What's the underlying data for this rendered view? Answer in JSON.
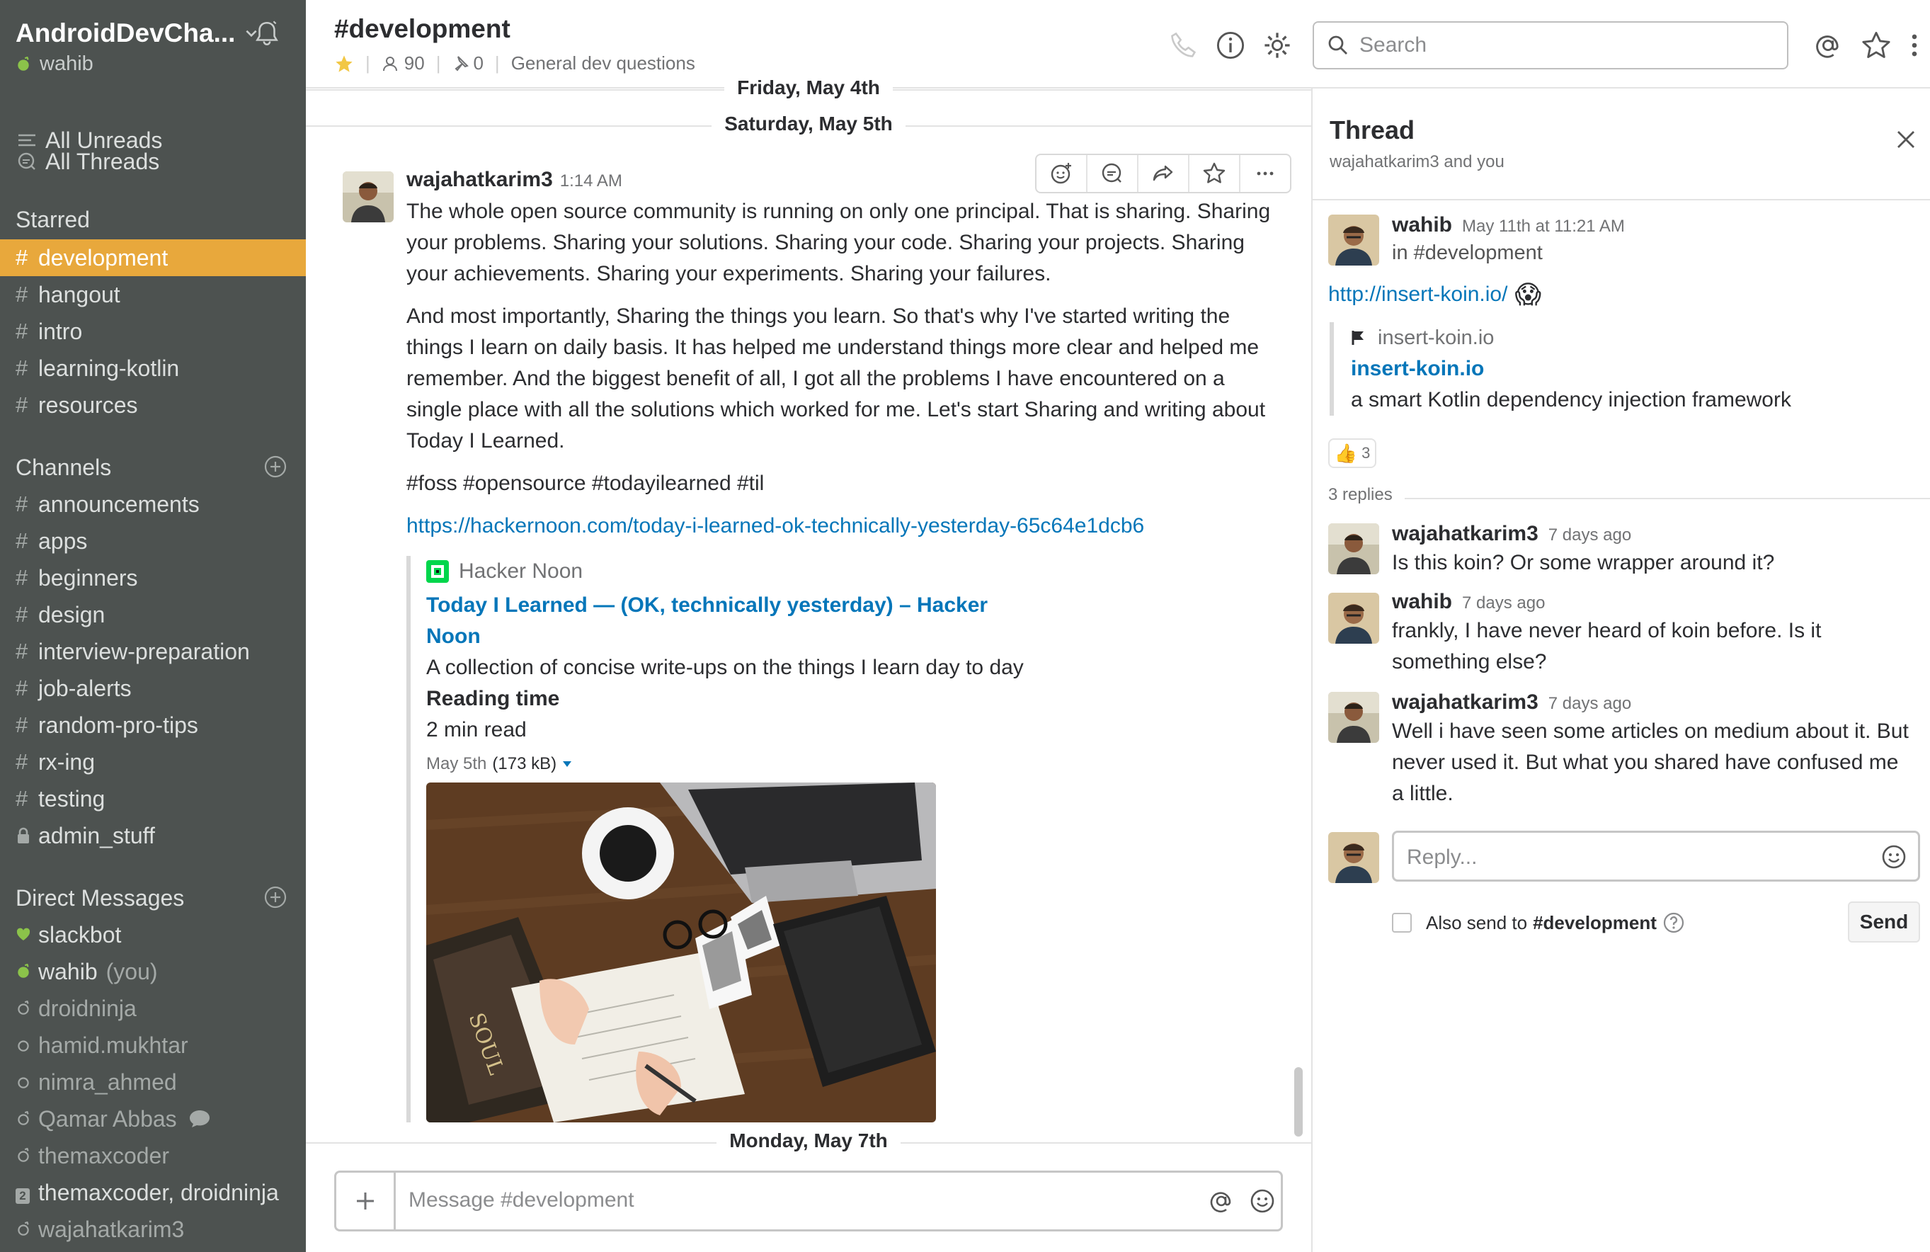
{
  "workspace": {
    "name": "AndroidDevCha...",
    "user": "wahib"
  },
  "sidebar": {
    "all_unreads": "All Unreads",
    "all_threads": "All Threads",
    "starred_heading": "Starred",
    "starred": [
      "development",
      "hangout",
      "intro",
      "learning-kotlin",
      "resources"
    ],
    "channels_heading": "Channels",
    "channels": [
      "announcements",
      "apps",
      "beginners",
      "design",
      "interview-preparation",
      "job-alerts",
      "random-pro-tips",
      "rx-ing",
      "testing",
      "admin_stuff"
    ],
    "dm_heading": "Direct Messages",
    "dms": {
      "slackbot": "slackbot",
      "wahib": "wahib",
      "you": "(you)",
      "droidninja": "droidninja",
      "hamid": "hamid.mukhtar",
      "nimra": "nimra_ahmed",
      "qamar": "Qamar Abbas",
      "themaxcoder": "themaxcoder",
      "group": "themaxcoder, droidninja",
      "group_count": "2",
      "wajahat": "wajahatkarim3"
    },
    "active_color": "#e8a83c",
    "bg_color": "#4d5250"
  },
  "header": {
    "channel": "#development",
    "members": "90",
    "pins": "0",
    "topic": "General dev questions",
    "search_placeholder": "Search"
  },
  "messages": {
    "day1": "Friday, May 4th",
    "day2": "Saturday, May 5th",
    "day3": "Monday, May 7th",
    "msg": {
      "author": "wajahatkarim3",
      "time": "1:14 AM",
      "p1": "The whole open source community is running on only one principal. That is sharing. Sharing your problems. Sharing your solutions. Sharing your code. Sharing your projects. Sharing your achievements. Sharing your experiments. Sharing your failures.",
      "p2": "And most importantly,  Sharing the things you learn. So that's why I've started writing the things I learn on daily basis. It has helped me understand things more clear and helped me remember. And the biggest benefit of all, I got all the problems I have encountered on a single place with all the solutions which worked for me. Let's start Sharing and writing about Today I Learned.",
      "tags": "#foss #opensource #todayilearned #til",
      "url": "https://hackernoon.com/today-i-learned-ok-technically-yesterday-65c64e1dcb6",
      "attachment": {
        "service": "Hacker Noon",
        "title": "Today I Learned — (OK, technically yesterday) – Hacker Noon",
        "description": "A collection of concise write-ups on the things I learn day to day",
        "field_label": "Reading time",
        "field_value": "2 min read",
        "file_date": "May 5th",
        "file_size": "(173 kB)"
      }
    },
    "composer_placeholder": "Message #development"
  },
  "thread": {
    "title": "Thread",
    "subtitle": "wajahatkarim3 and you",
    "parent": {
      "author": "wahib",
      "time": "May 11th at 11:21 AM",
      "channel": "in #development",
      "link": "http://insert-koin.io/",
      "emoji": "😱",
      "unfurl_site": "insert-koin.io",
      "unfurl_title": "insert-koin.io",
      "unfurl_desc": "a smart Kotlin dependency injection framework",
      "reaction_emoji": "👍",
      "reaction_count": "3"
    },
    "replies_count": "3 replies",
    "replies": [
      {
        "author": "wajahatkarim3",
        "time": "7 days ago",
        "text": "Is this koin? Or some wrapper around it?"
      },
      {
        "author": "wahib",
        "time": "7 days ago",
        "text": "frankly, I have never heard of koin before. Is it something else?"
      },
      {
        "author": "wajahatkarim3",
        "time": "7 days ago",
        "text": "Well i have seen some articles on medium about it. But never used it. But what you shared have confused me a little."
      }
    ],
    "reply_placeholder": "Reply...",
    "also_send": "Also send to",
    "also_channel": "#development",
    "send_label": "Send"
  },
  "colors": {
    "link": "#0576b9",
    "online": "#8bc34a"
  }
}
